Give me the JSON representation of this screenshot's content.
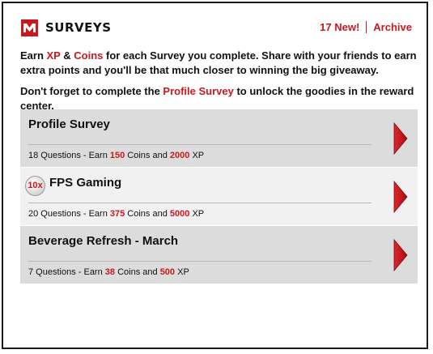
{
  "header": {
    "title": "SURVEYS",
    "new_link": "17 New!",
    "archive_link": "Archive",
    "logo_icon": "brand-logo-icon",
    "accent": "#c8191e"
  },
  "intro": {
    "p1_a": "Earn ",
    "p1_xp": "XP",
    "p1_b": " & ",
    "p1_coins": "Coins",
    "p1_c": " for each Survey you complete. Share with your friends to earn extra points and you'll be that much closer to winning the big giveaway.",
    "p2_a": "Don't forget to complete the ",
    "p2_link": "Profile Survey",
    "p2_b": " to unlock the goodies in the reward center."
  },
  "surveys": [
    {
      "title": "Profile Survey",
      "badge": "",
      "questions": "18 Questions - Earn ",
      "coins": "150",
      "coins_label": " Coins and ",
      "xp": "2000",
      "xp_label": " XP"
    },
    {
      "title": "FPS Gaming",
      "badge": "10x",
      "questions": "20 Questions - Earn ",
      "coins": "375",
      "coins_label": " Coins and ",
      "xp": "5000",
      "xp_label": " XP"
    },
    {
      "title": "Beverage Refresh - March",
      "badge": "",
      "questions": "7 Questions - Earn ",
      "coins": "38",
      "coins_label": " Coins and ",
      "xp": "500",
      "xp_label": " XP"
    }
  ]
}
